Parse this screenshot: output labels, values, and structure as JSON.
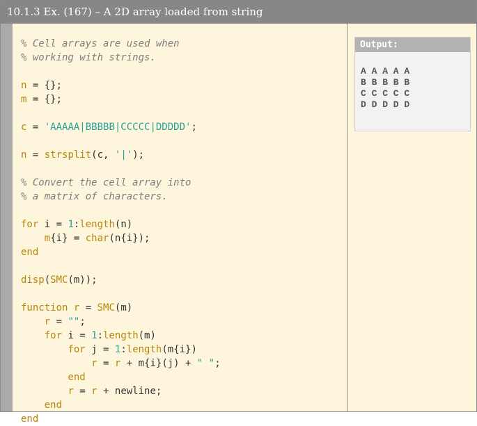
{
  "title": "10.1.3 Ex. (167) – A 2D array loaded from string",
  "code_lines": [
    [
      {
        "t": "% Cell arrays are used when",
        "c": "comment"
      }
    ],
    [
      {
        "t": "% working with strings.",
        "c": "comment"
      }
    ],
    [],
    [
      {
        "t": "n",
        "c": "kw"
      },
      {
        "t": " = {};",
        "c": "plain"
      }
    ],
    [
      {
        "t": "m",
        "c": "kw"
      },
      {
        "t": " = {};",
        "c": "plain"
      }
    ],
    [],
    [
      {
        "t": "c",
        "c": "kw"
      },
      {
        "t": " = ",
        "c": "plain"
      },
      {
        "t": "'AAAAA|BBBBB|CCCCC|DDDDD'",
        "c": "str"
      },
      {
        "t": ";",
        "c": "plain"
      }
    ],
    [],
    [
      {
        "t": "n",
        "c": "kw"
      },
      {
        "t": " = ",
        "c": "plain"
      },
      {
        "t": "strsplit",
        "c": "call"
      },
      {
        "t": "(c, ",
        "c": "plain"
      },
      {
        "t": "'|'",
        "c": "str"
      },
      {
        "t": ");",
        "c": "plain"
      }
    ],
    [],
    [
      {
        "t": "% Convert the cell array into",
        "c": "comment"
      }
    ],
    [
      {
        "t": "% a matrix of characters.",
        "c": "comment"
      }
    ],
    [],
    [
      {
        "t": "for",
        "c": "kw"
      },
      {
        "t": " i = ",
        "c": "plain"
      },
      {
        "t": "1",
        "c": "num"
      },
      {
        "t": ":",
        "c": "plain"
      },
      {
        "t": "length",
        "c": "call"
      },
      {
        "t": "(n)",
        "c": "plain"
      }
    ],
    [
      {
        "t": "    ",
        "c": "plain"
      },
      {
        "t": "m",
        "c": "kw"
      },
      {
        "t": "{i} = ",
        "c": "plain"
      },
      {
        "t": "char",
        "c": "call"
      },
      {
        "t": "(n{i});",
        "c": "plain"
      }
    ],
    [
      {
        "t": "end",
        "c": "kw"
      }
    ],
    [],
    [
      {
        "t": "disp",
        "c": "call"
      },
      {
        "t": "(",
        "c": "plain"
      },
      {
        "t": "SMC",
        "c": "call"
      },
      {
        "t": "(m));",
        "c": "plain"
      }
    ],
    [],
    [
      {
        "t": "function",
        "c": "kw"
      },
      {
        "t": " ",
        "c": "plain"
      },
      {
        "t": "r",
        "c": "kw"
      },
      {
        "t": " = ",
        "c": "plain"
      },
      {
        "t": "SMC",
        "c": "call"
      },
      {
        "t": "(m)",
        "c": "plain"
      }
    ],
    [
      {
        "t": "    ",
        "c": "plain"
      },
      {
        "t": "r",
        "c": "kw"
      },
      {
        "t": " = ",
        "c": "plain"
      },
      {
        "t": "\"\"",
        "c": "str"
      },
      {
        "t": ";",
        "c": "plain"
      }
    ],
    [
      {
        "t": "    ",
        "c": "plain"
      },
      {
        "t": "for",
        "c": "kw"
      },
      {
        "t": " i = ",
        "c": "plain"
      },
      {
        "t": "1",
        "c": "num"
      },
      {
        "t": ":",
        "c": "plain"
      },
      {
        "t": "length",
        "c": "call"
      },
      {
        "t": "(m)",
        "c": "plain"
      }
    ],
    [
      {
        "t": "        ",
        "c": "plain"
      },
      {
        "t": "for",
        "c": "kw"
      },
      {
        "t": " j = ",
        "c": "plain"
      },
      {
        "t": "1",
        "c": "num"
      },
      {
        "t": ":",
        "c": "plain"
      },
      {
        "t": "length",
        "c": "call"
      },
      {
        "t": "(m{i})",
        "c": "plain"
      }
    ],
    [
      {
        "t": "            ",
        "c": "plain"
      },
      {
        "t": "r",
        "c": "kw"
      },
      {
        "t": " = ",
        "c": "plain"
      },
      {
        "t": "r",
        "c": "kw"
      },
      {
        "t": " + m{i}(j) + ",
        "c": "plain"
      },
      {
        "t": "\" \"",
        "c": "str"
      },
      {
        "t": ";",
        "c": "plain"
      }
    ],
    [
      {
        "t": "        ",
        "c": "plain"
      },
      {
        "t": "end",
        "c": "kw"
      }
    ],
    [
      {
        "t": "        ",
        "c": "plain"
      },
      {
        "t": "r",
        "c": "kw"
      },
      {
        "t": " = ",
        "c": "plain"
      },
      {
        "t": "r",
        "c": "kw"
      },
      {
        "t": " + newline;",
        "c": "plain"
      }
    ],
    [
      {
        "t": "    ",
        "c": "plain"
      },
      {
        "t": "end",
        "c": "kw"
      }
    ],
    [
      {
        "t": "end",
        "c": "kw"
      }
    ]
  ],
  "output": {
    "label": "Output:",
    "lines": [
      "A A A A A",
      "B B B B B",
      "C C C C C",
      "D D D D D"
    ]
  },
  "colors": {
    "background": "#fdf5dc",
    "title_bar": "#878787",
    "comment": "#7f7f7f",
    "keyword": "#b8860b",
    "string": "#2aa198"
  }
}
